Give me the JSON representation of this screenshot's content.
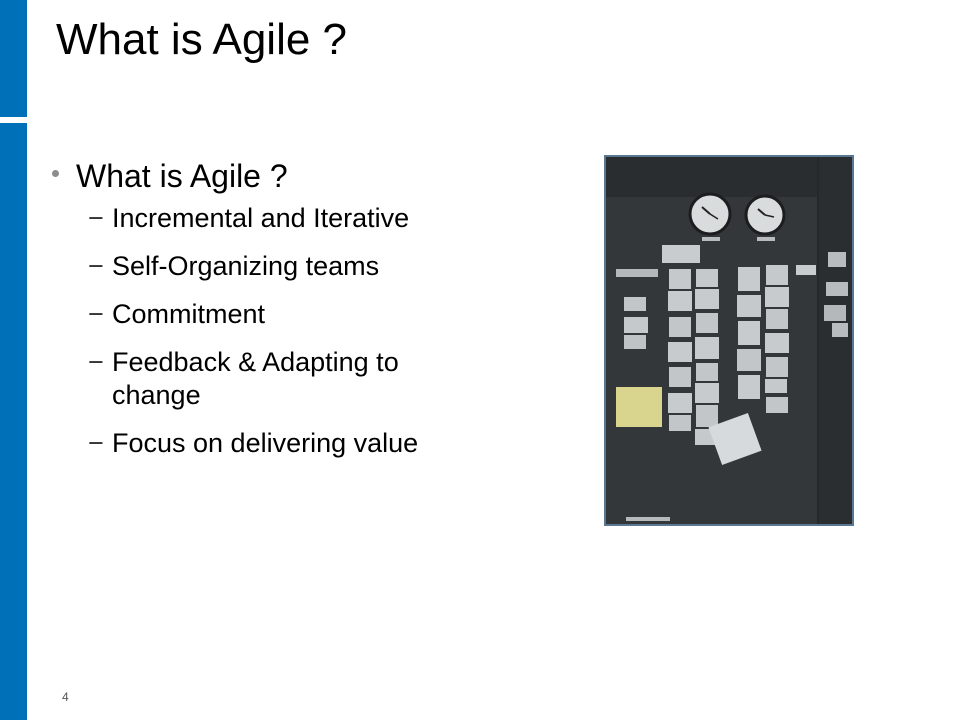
{
  "slide": {
    "title": "What is Agile ?",
    "bullet": {
      "text": "What is Agile ?",
      "sub_items": [
        "Incremental and Iterative",
        "Self-Organizing teams",
        "Commitment",
        "Feedback & Adapting to change",
        "Focus on delivering value"
      ]
    },
    "page_number": "4",
    "accent_color": "#0070b8"
  }
}
